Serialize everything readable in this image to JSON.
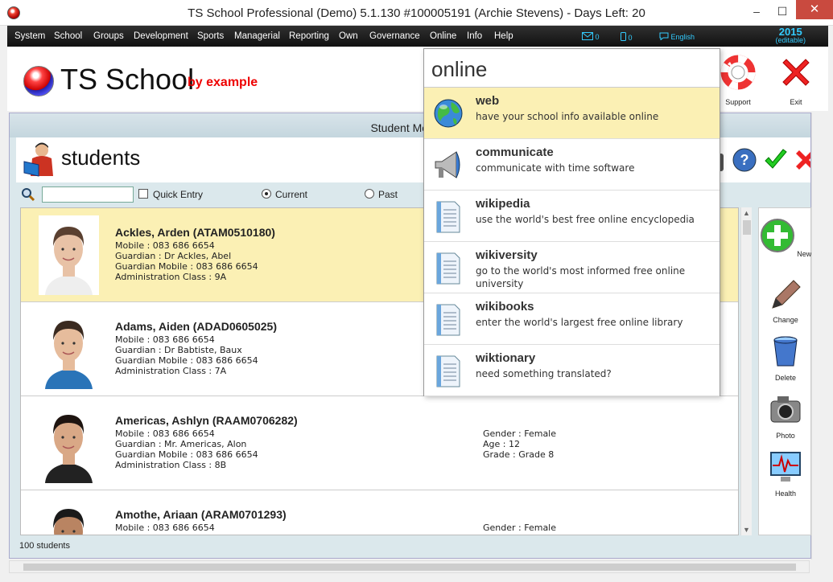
{
  "window": {
    "title": "TS School Professional (Demo) 5.1.130 #100005191 (Archie Stevens) - Days Left: 20",
    "minimize": "–",
    "maximize": "☐",
    "close": "✕"
  },
  "menubar": {
    "items": [
      "System",
      "School",
      "Groups",
      "Development",
      "Sports",
      "Managerial",
      "Reporting",
      "Own",
      "Governance",
      "Online",
      "Info",
      "Help"
    ],
    "mail_count": "0",
    "sms_count": "0",
    "language": "English",
    "year": "2015",
    "year_note": "(editable)"
  },
  "header": {
    "logo_text": "TS School",
    "logo_by": "by example",
    "tools": [
      {
        "label": "Support",
        "icon": "lifebuoy-icon"
      },
      {
        "label": "Exit",
        "icon": "exit-x-icon"
      }
    ]
  },
  "module": {
    "title": "Student Module",
    "heading": "students",
    "filter": {
      "search_value": "",
      "quick_entry_label": "Quick Entry",
      "current_label": "Current",
      "past_label": "Past"
    },
    "count_text": "100 students"
  },
  "students": [
    {
      "name": "Ackles, Arden (ATAM0510180)",
      "mobile": "Mobile : 083 686 6654",
      "guardian": "Guardian : Dr Ackles, Abel",
      "guardian_mobile": "Guardian Mobile : 083 686 6654",
      "admin_class": "Administration Class : 9A",
      "gender": "",
      "age": "",
      "grade": "",
      "selected": true,
      "hair": "#5a4030",
      "skin": "#e8c2a6",
      "shirt": "#eeeeee"
    },
    {
      "name": "Adams, Aiden (ADAD0605025)",
      "mobile": "Mobile : 083 686 6654",
      "guardian": "Guardian : Dr Babtiste, Baux",
      "guardian_mobile": "Guardian Mobile : 083 686 6654",
      "admin_class": "Administration Class : 7A",
      "gender": "",
      "age": "",
      "grade": "",
      "selected": false,
      "hair": "#3a2a20",
      "skin": "#e6bc9c",
      "shirt": "#2a74b8"
    },
    {
      "name": "Americas, Ashlyn (RAAM0706282)",
      "mobile": "Mobile : 083 686 6654",
      "guardian": "Guardian : Mr. Americas, Alon",
      "guardian_mobile": "Guardian Mobile : 083 686 6654",
      "admin_class": "Administration Class : 8B",
      "gender": "Gender : Female",
      "age": "Age : 12",
      "grade": "Grade : Grade 8",
      "selected": false,
      "hair": "#1e1410",
      "skin": "#d9a886",
      "shirt": "#222222"
    },
    {
      "name": "Amothe, Ariaan (ARAM0701293)",
      "mobile": "Mobile : 083 686 6654",
      "guardian": "",
      "guardian_mobile": "",
      "admin_class": "",
      "gender": "Gender : Female",
      "age": "",
      "grade": "",
      "selected": false,
      "hair": "#1a1a1a",
      "skin": "#b98462",
      "shirt": "#dddddd"
    }
  ],
  "side_tools": [
    {
      "label": "New",
      "icon": "new-plus-icon"
    },
    {
      "label": "Change",
      "icon": "pen-icon"
    },
    {
      "label": "Delete",
      "icon": "trash-icon"
    },
    {
      "label": "Photo",
      "icon": "camera-icon"
    },
    {
      "label": "Health",
      "icon": "health-monitor-icon"
    }
  ],
  "online_menu": {
    "title": "online",
    "items": [
      {
        "name": "web",
        "desc": "have your school info available online",
        "icon": "globe-icon",
        "highlighted": true
      },
      {
        "name": "communicate",
        "desc": "communicate with time software",
        "icon": "megaphone-icon",
        "highlighted": false
      },
      {
        "name": "wikipedia",
        "desc": "use the world's best free online encyclopedia",
        "icon": "document-icon",
        "highlighted": false
      },
      {
        "name": "wikiversity",
        "desc": "go to the world's most informed free online university",
        "icon": "document-icon",
        "highlighted": false
      },
      {
        "name": "wikibooks",
        "desc": "enter the world's largest free online library",
        "icon": "document-icon",
        "highlighted": false
      },
      {
        "name": "wiktionary",
        "desc": "need something translated?",
        "icon": "document-icon",
        "highlighted": false
      }
    ]
  },
  "colors": {
    "selected_row": "#fbf0b4",
    "accent_cyan": "#33ccff",
    "logo_red": "#ee0000"
  }
}
